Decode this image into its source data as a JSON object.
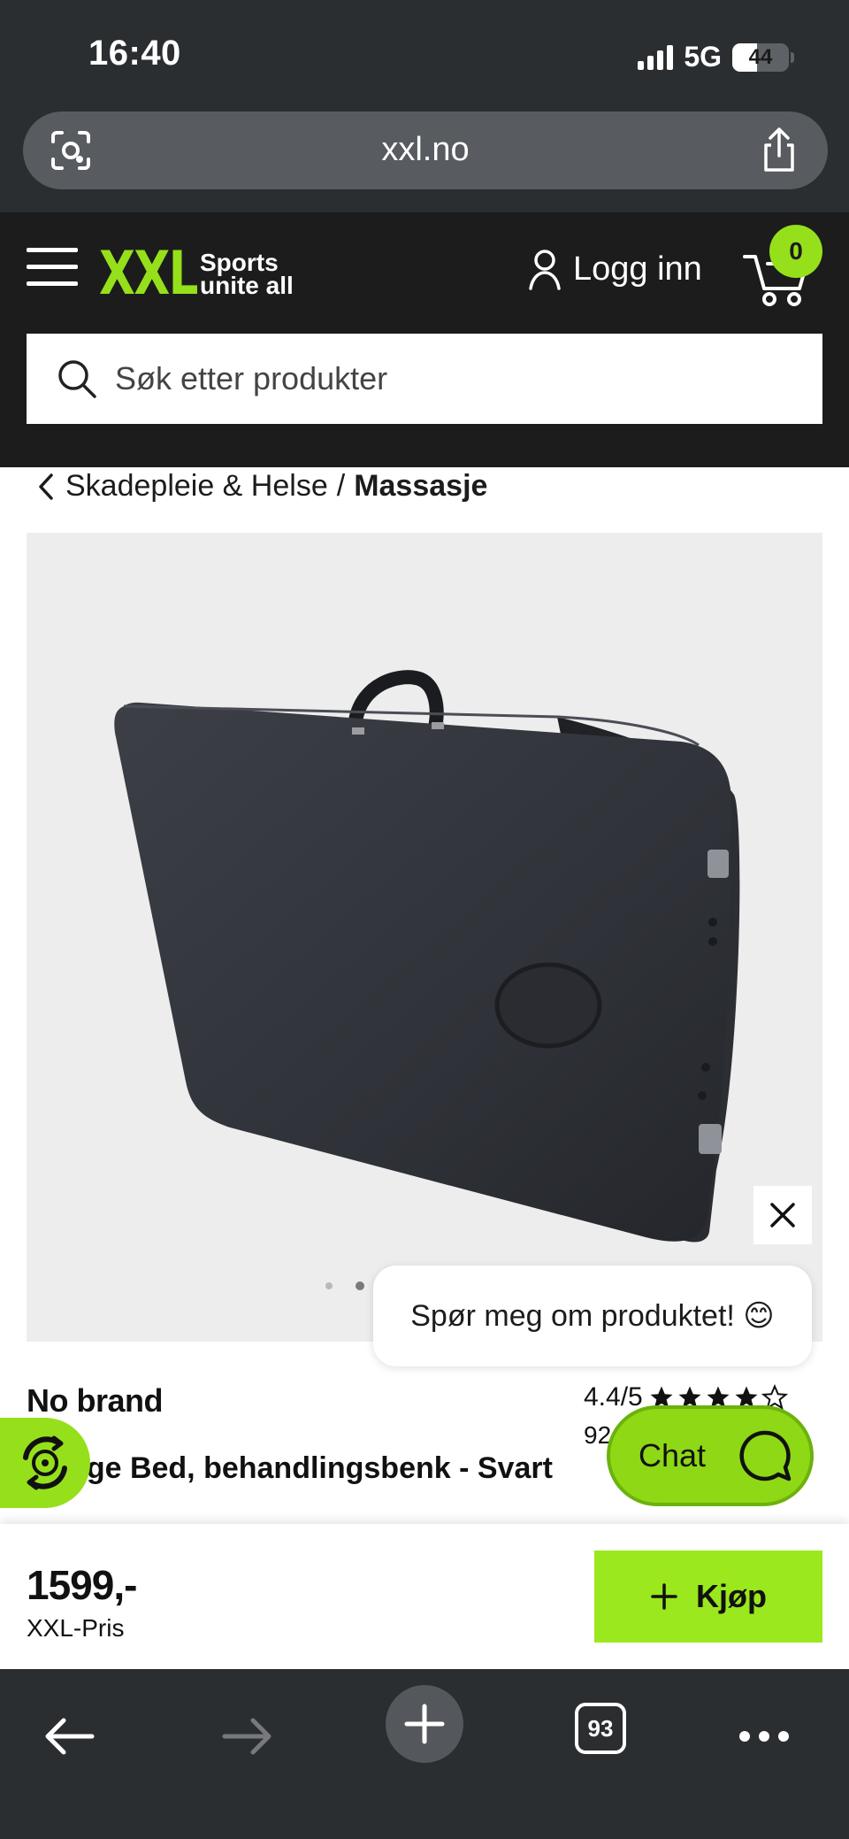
{
  "status_bar": {
    "time": "16:40",
    "network": "5G",
    "battery": "44",
    "battery_fraction": 0.44
  },
  "browser": {
    "url": "xxl.no",
    "tab_count": "93"
  },
  "header": {
    "logo_text": "XXL",
    "tagline_line1": "Sports",
    "tagline_line2": "unite all",
    "login_label": "Logg inn",
    "cart_count": "0",
    "brand_color": "#96e01b"
  },
  "search": {
    "placeholder": "Søk etter produkter"
  },
  "breadcrumb": {
    "parent": "Skadepleie & Helse",
    "separator": "/",
    "current": "Massasje"
  },
  "gallery": {
    "image_count": 2,
    "active_index": 1
  },
  "chat": {
    "prompt": "Spør meg om produktet! 😊",
    "button_label": "Chat"
  },
  "product": {
    "brand": "No brand",
    "rating": "4.4/5",
    "rating_value": 4.4,
    "review_count": "92",
    "title": "sage Bed, behandlingsbenk - Svart"
  },
  "price_bar": {
    "price": "1599,-",
    "price_label": "XXL-Pris",
    "buy_label": "Kjøp"
  },
  "icons": [
    "camera-lens-icon",
    "share-icon",
    "hamburger-menu-icon",
    "user-icon",
    "cart-icon",
    "search-icon",
    "chevron-left-icon",
    "close-icon",
    "chat-icon",
    "wheel-badge-icon",
    "plus-icon",
    "back-arrow-icon",
    "forward-arrow-icon",
    "new-tab-icon",
    "more-icon"
  ]
}
